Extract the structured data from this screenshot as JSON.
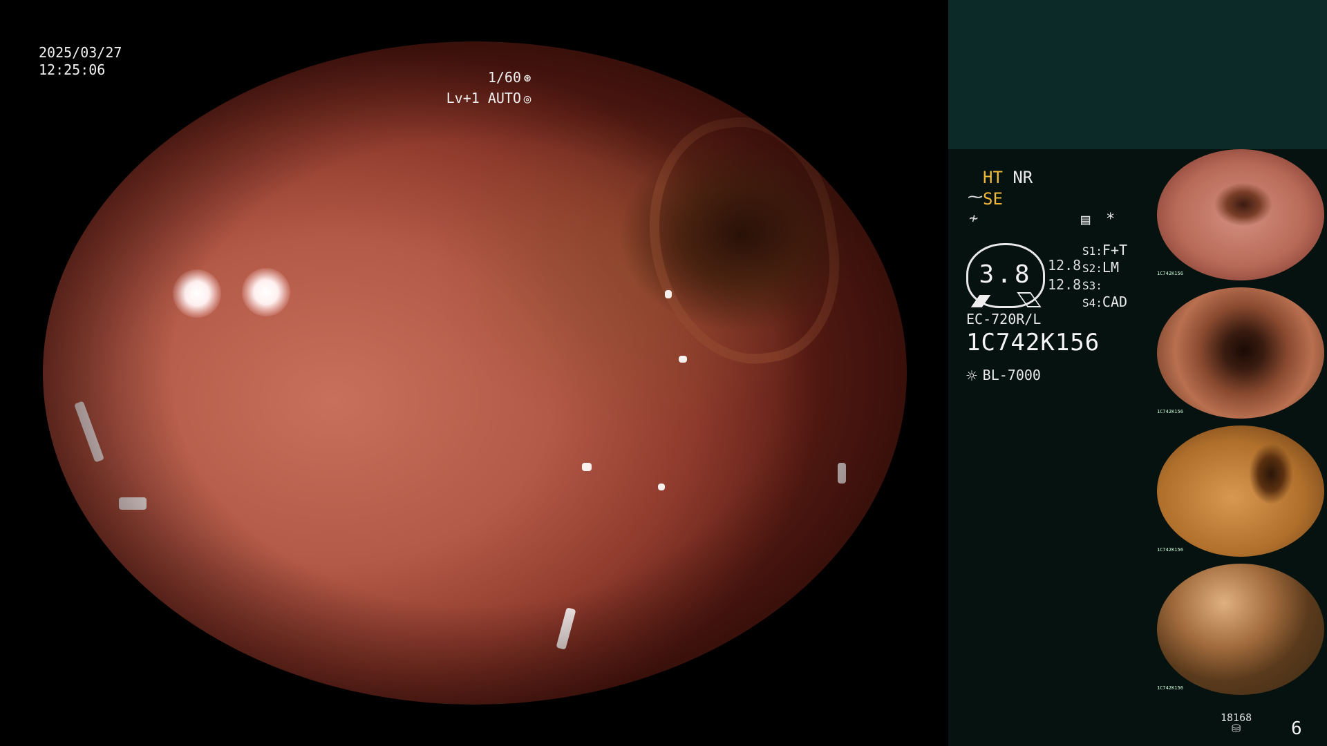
{
  "overlay": {
    "date": "2025/03/27",
    "time": "12:25:06",
    "shutter": "1/60",
    "shutter_icon": "aperture-icon",
    "level": "Lv+1",
    "exposure_mode": "AUTO",
    "exposure_icon": "target-icon"
  },
  "panel": {
    "modes": [
      {
        "label": "HT",
        "state": "on"
      },
      {
        "label": "NR",
        "state": "off"
      }
    ],
    "se_label": "SE",
    "gauge_value": "3.8",
    "side_values": [
      "12.8",
      "12.8"
    ],
    "settings": [
      {
        "key": "S1:",
        "value": "F+T"
      },
      {
        "key": "S2:",
        "value": "LM"
      },
      {
        "key": "S3:",
        "value": ""
      },
      {
        "key": "S4:",
        "value": "CAD"
      }
    ],
    "asterisk": "*",
    "scope_model": "EC-720R/L",
    "scope_serial": "1C742K156",
    "light_source": "BL-7000",
    "thumbnails": [
      {
        "id": "1",
        "serial": "1C742K156"
      },
      {
        "id": "2",
        "serial": "1C742K156"
      },
      {
        "id": "3",
        "serial": "1C742K156"
      },
      {
        "id": "4",
        "serial": "1C742K156"
      }
    ],
    "frame_count": "18168",
    "page_number": "6"
  },
  "colors": {
    "panel_bg": "#061210",
    "panel_header_bg": "#0c2a27",
    "mode_active": "#f0b93a",
    "mucosa": "#b45a48"
  }
}
